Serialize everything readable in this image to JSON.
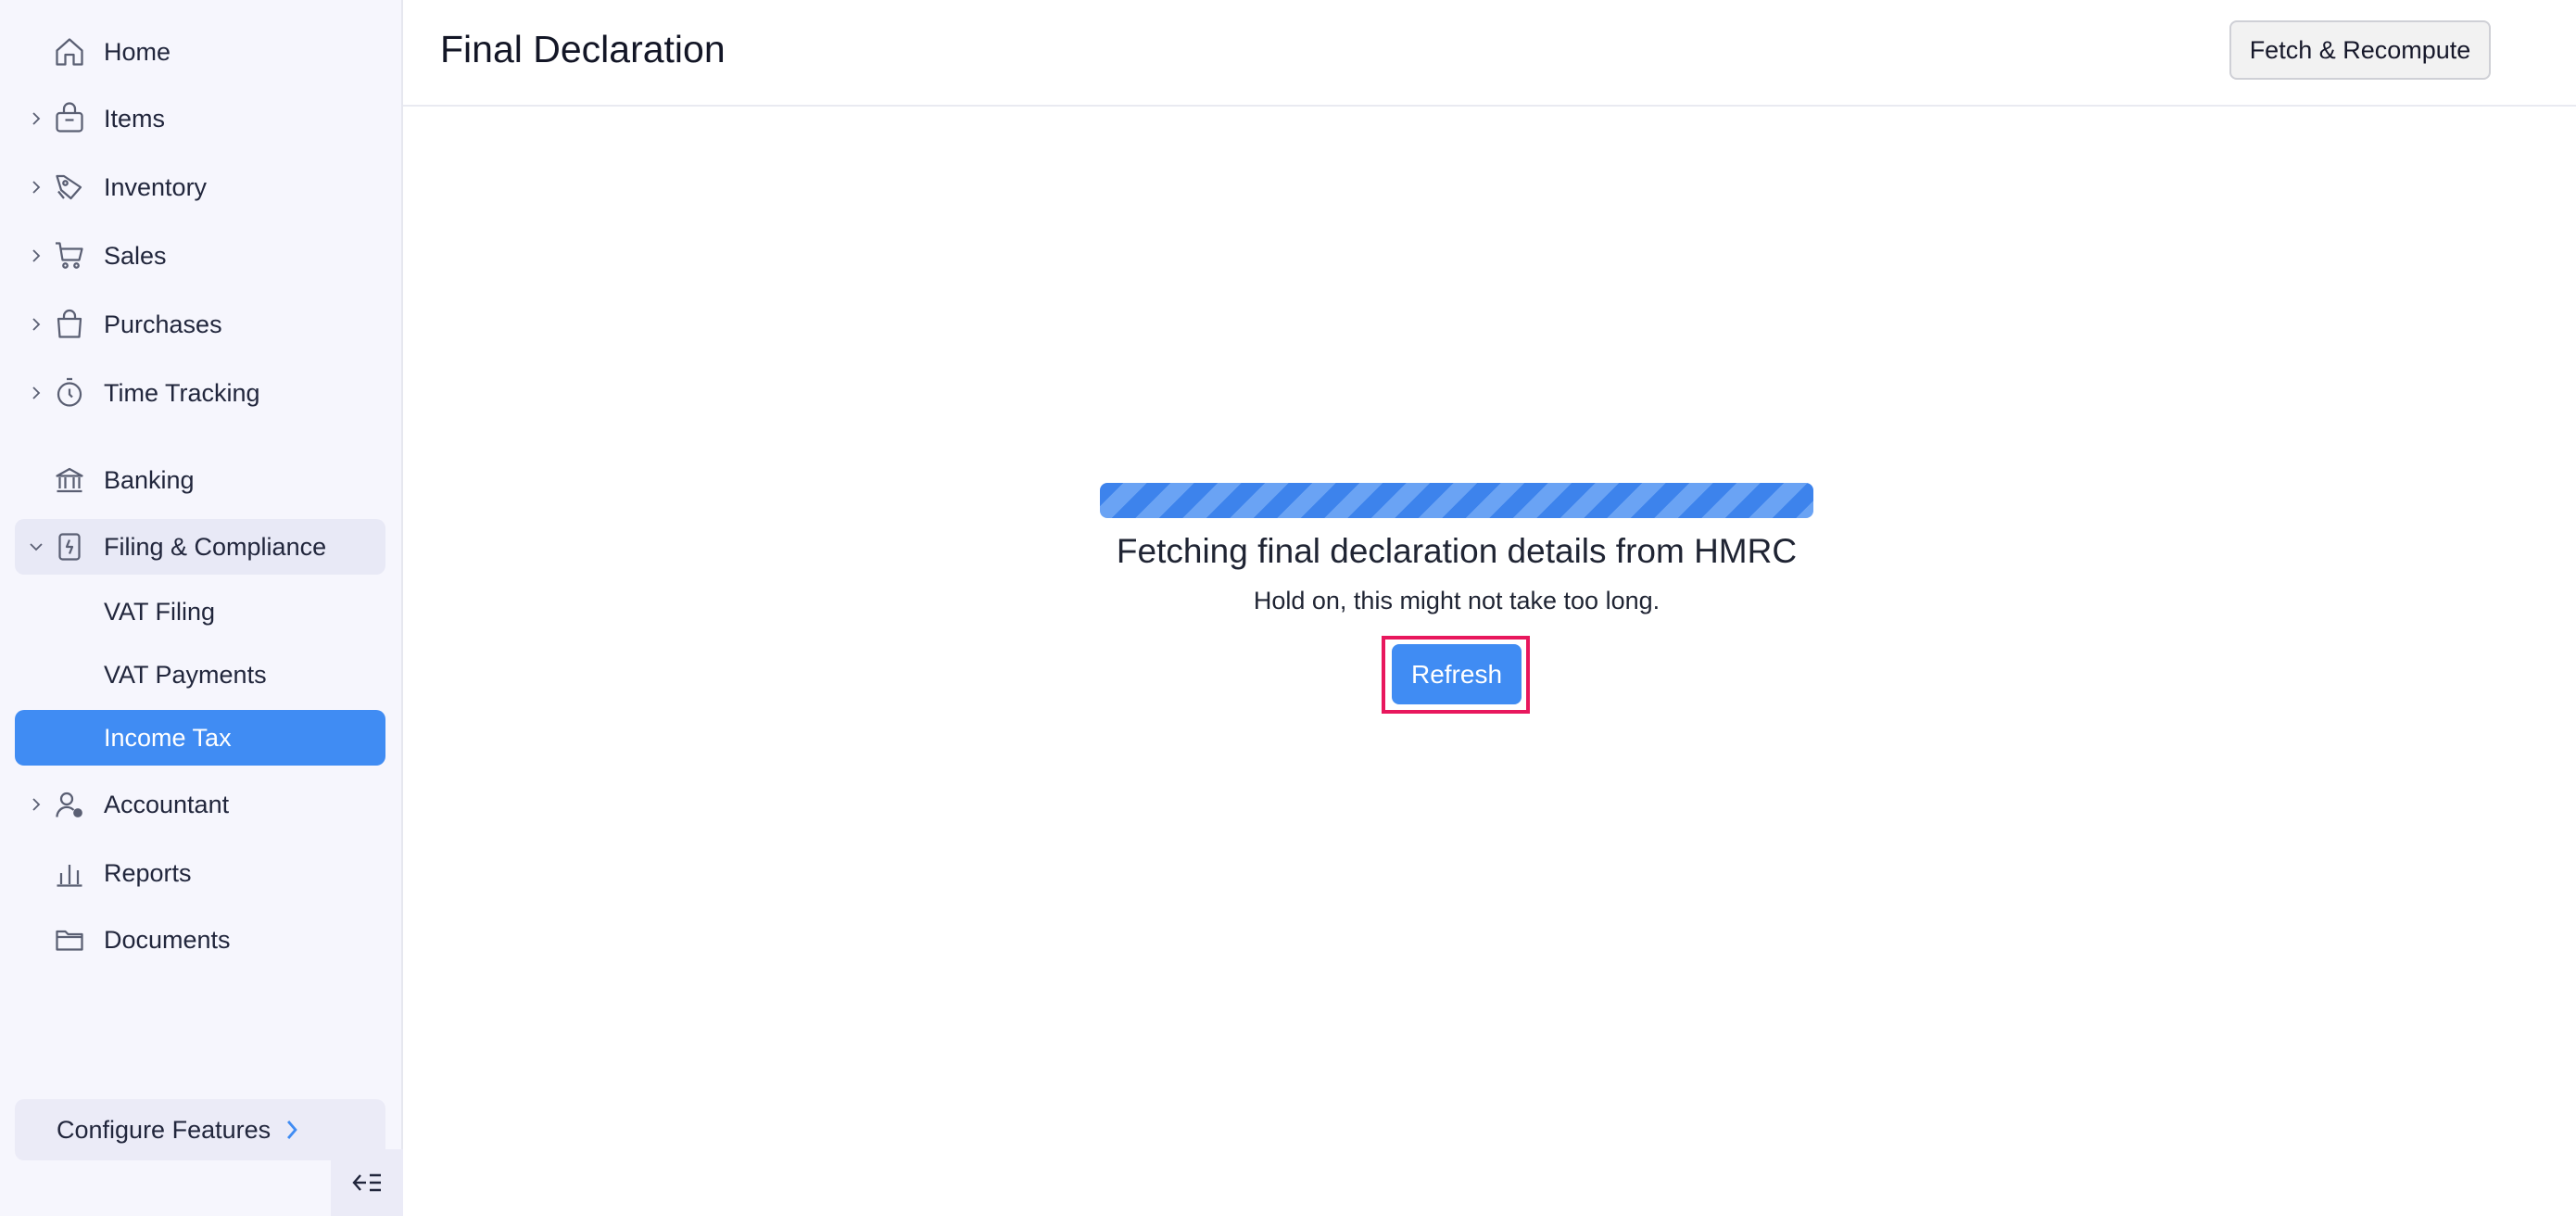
{
  "sidebar": {
    "items": [
      {
        "label": "Home",
        "icon": "home-icon"
      },
      {
        "label": "Items",
        "icon": "items-icon"
      },
      {
        "label": "Inventory",
        "icon": "inventory-icon"
      },
      {
        "label": "Sales",
        "icon": "cart-icon"
      },
      {
        "label": "Purchases",
        "icon": "bag-icon"
      },
      {
        "label": "Time Tracking",
        "icon": "stopwatch-icon"
      },
      {
        "label": "Banking",
        "icon": "bank-icon"
      },
      {
        "label": "Filing & Compliance",
        "icon": "filing-icon"
      },
      {
        "label": "VAT Filing"
      },
      {
        "label": "VAT Payments"
      },
      {
        "label": "Income Tax"
      },
      {
        "label": "Accountant",
        "icon": "accountant-icon"
      },
      {
        "label": "Reports",
        "icon": "reports-icon"
      },
      {
        "label": "Documents",
        "icon": "folder-icon"
      }
    ],
    "active_item": "Income Tax",
    "configure_label": "Configure Features"
  },
  "header": {
    "title": "Final Declaration",
    "fetch_button": "Fetch & Recompute"
  },
  "loader": {
    "title": "Fetching final declaration details from HMRC",
    "subtitle": "Hold on, this might not take too long.",
    "refresh_button": "Refresh"
  },
  "colors": {
    "accent": "#408cf3",
    "sidebar_bg": "#f6f6fd",
    "highlight": "#e8175d"
  }
}
